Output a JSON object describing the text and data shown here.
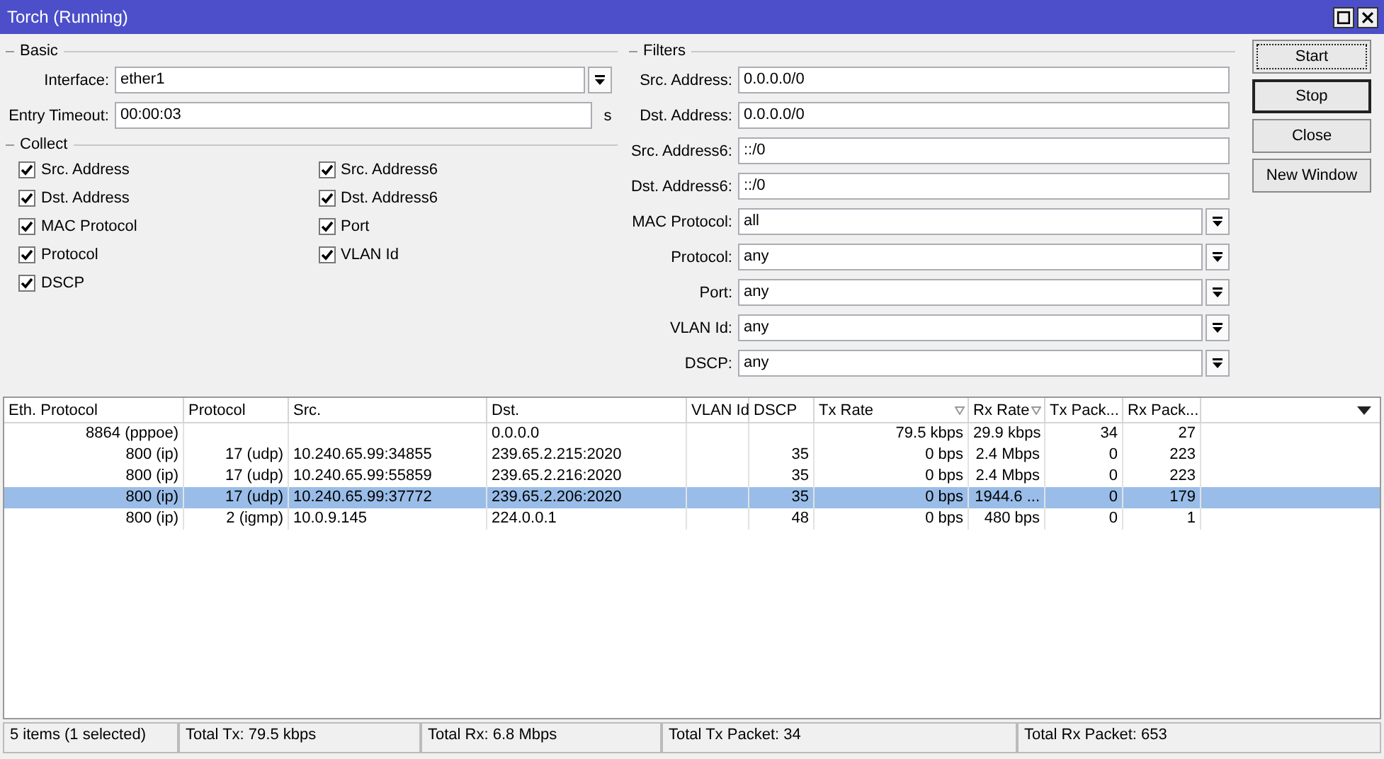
{
  "window": {
    "title": "Torch (Running)"
  },
  "basic": {
    "title": "Basic",
    "fields": [
      {
        "label": "Interface:",
        "value": "ether1",
        "kind": "dropdown"
      },
      {
        "label": "Entry Timeout:",
        "value": "00:00:03",
        "kind": "text",
        "unit": "s"
      }
    ]
  },
  "collect": {
    "title": "Collect",
    "columns": [
      [
        {
          "label": "Src. Address",
          "checked": true
        },
        {
          "label": "Dst. Address",
          "checked": true
        },
        {
          "label": "MAC Protocol",
          "checked": true
        },
        {
          "label": "Protocol",
          "checked": true
        },
        {
          "label": "DSCP",
          "checked": true
        }
      ],
      [
        {
          "label": "Src. Address6",
          "checked": true
        },
        {
          "label": "Dst. Address6",
          "checked": true
        },
        {
          "label": "Port",
          "checked": true
        },
        {
          "label": "VLAN Id",
          "checked": true
        }
      ]
    ]
  },
  "filters": {
    "title": "Filters",
    "fields": [
      {
        "label": "Src. Address:",
        "value": "0.0.0.0/0",
        "kind": "text"
      },
      {
        "label": "Dst. Address:",
        "value": "0.0.0.0/0",
        "kind": "text"
      },
      {
        "label": "Src. Address6:",
        "value": "::/0",
        "kind": "text"
      },
      {
        "label": "Dst. Address6:",
        "value": "::/0",
        "kind": "text"
      },
      {
        "label": "MAC Protocol:",
        "value": "all",
        "kind": "dropdown"
      },
      {
        "label": "Protocol:",
        "value": "any",
        "kind": "dropdown"
      },
      {
        "label": "Port:",
        "value": "any",
        "kind": "dropdown"
      },
      {
        "label": "VLAN Id:",
        "value": "any",
        "kind": "dropdown"
      },
      {
        "label": "DSCP:",
        "value": "any",
        "kind": "dropdown"
      }
    ]
  },
  "buttons": [
    {
      "label": "Start",
      "kind": "focused"
    },
    {
      "label": "Stop",
      "kind": "default"
    },
    {
      "label": "Close",
      "kind": "normal"
    },
    {
      "label": "New Window",
      "kind": "normal"
    }
  ],
  "table": {
    "columns": [
      {
        "label": "Eth. Protocol",
        "sorted": false
      },
      {
        "label": "Protocol",
        "sorted": false
      },
      {
        "label": "Src.",
        "sorted": false
      },
      {
        "label": "Dst.",
        "sorted": false
      },
      {
        "label": "VLAN Id",
        "sorted": false
      },
      {
        "label": "DSCP",
        "sorted": false
      },
      {
        "label": "Tx Rate",
        "sorted": true
      },
      {
        "label": "Rx Rate",
        "sorted": true
      },
      {
        "label": "Tx Pack...",
        "sorted": false
      },
      {
        "label": "Rx Pack...",
        "sorted": false
      }
    ],
    "rows": [
      {
        "selected": false,
        "cells": [
          "8864 (pppoe)",
          "",
          "",
          "0.0.0.0",
          "",
          "",
          "79.5 kbps",
          "29.9 kbps",
          "34",
          "27"
        ]
      },
      {
        "selected": false,
        "cells": [
          "800 (ip)",
          "17 (udp)",
          "10.240.65.99:34855",
          "239.65.2.215:2020",
          "",
          "35",
          "0 bps",
          "2.4 Mbps",
          "0",
          "223"
        ]
      },
      {
        "selected": false,
        "cells": [
          "800 (ip)",
          "17 (udp)",
          "10.240.65.99:55859",
          "239.65.2.216:2020",
          "",
          "35",
          "0 bps",
          "2.4 Mbps",
          "0",
          "223"
        ]
      },
      {
        "selected": true,
        "cells": [
          "800 (ip)",
          "17 (udp)",
          "10.240.65.99:37772",
          "239.65.2.206:2020",
          "",
          "35",
          "0 bps",
          "1944.6 ...",
          "0",
          "179"
        ]
      },
      {
        "selected": false,
        "cells": [
          "800 (ip)",
          "2 (igmp)",
          "10.0.9.145",
          "224.0.0.1",
          "",
          "48",
          "0 bps",
          "480 bps",
          "0",
          "1"
        ]
      }
    ]
  },
  "status_bar": [
    "5 items (1 selected)",
    "Total Tx: 79.5 kbps",
    "Total Rx: 6.8 Mbps",
    "Total Tx Packet: 34",
    "Total Rx Packet: 653"
  ]
}
